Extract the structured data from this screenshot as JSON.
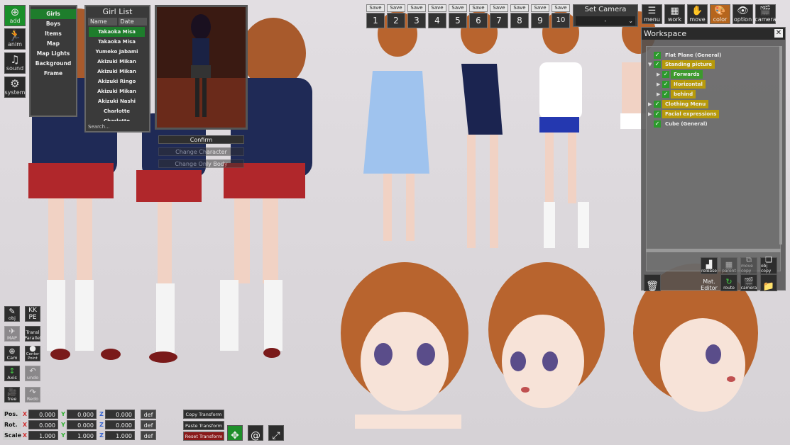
{
  "side_menu": {
    "add": "add",
    "anim": "anim",
    "sound": "sound",
    "system": "system"
  },
  "category_list": [
    "Girls",
    "Boys",
    "Items",
    "Map",
    "Map Lights",
    "Background",
    "Frame"
  ],
  "girl_list": {
    "title": "Girl List",
    "sort_name": "Name",
    "sort_date": "Date",
    "rows": [
      "Takaoka Misa",
      "Takaoka Misa",
      "Yumeko Jabami",
      "Akizuki Mikan",
      "Akizuki Mikan",
      "Akizuki Ringo",
      "Akizuki Mikan",
      "Akizuki Nashi",
      "Charlotte",
      "Charlotte"
    ],
    "search_placeholder": "Search..."
  },
  "preview_buttons": {
    "confirm": "Confirm",
    "change_character": "Change Character",
    "change_only_body": "Change Only Body"
  },
  "camera_slots": {
    "save_label": "Save",
    "numbers": [
      "1",
      "2",
      "3",
      "4",
      "5",
      "6",
      "7",
      "8",
      "9",
      "10"
    ]
  },
  "set_camera": {
    "title": "Set Camera",
    "value": "-"
  },
  "top_icons": [
    "menu",
    "work",
    "move",
    "color",
    "option",
    "camera"
  ],
  "workspace": {
    "title": "Workspace",
    "close": "✕",
    "nodes": [
      "Flat Plane (General)",
      "Standing picture",
      "Forwards",
      "Horizontal",
      "behind",
      "Clothing Menu",
      "Facial expressions",
      "Cube (General)"
    ],
    "buttons": {
      "release": "release",
      "parent": "parent",
      "move_copy": "move copy",
      "obj_copy": "obj copy",
      "mat_editor_line1": "Mat.",
      "mat_editor_line2": "Editor",
      "route": "route",
      "camera": "camera"
    }
  },
  "tools": {
    "obj": "obj",
    "kkpe_line1": "KK",
    "kkpe_line2": "PE",
    "map": "MAP",
    "transl_line1": "Transl",
    "transl_line2": "Parallel",
    "cam": "Cam",
    "center_line1": "Center",
    "center_line2": "Point",
    "axis": "Axis",
    "undo": "undo",
    "free": "free",
    "redo": "Redo"
  },
  "transform": {
    "pos_label": "Pos.",
    "rot_label": "Rot.",
    "scale_label": "Scale",
    "axis_x": "X",
    "axis_y": "Y",
    "axis_z": "Z",
    "pos": [
      "0.000",
      "0.000",
      "0.000"
    ],
    "rot": [
      "0.000",
      "0.000",
      "0.000"
    ],
    "scale": [
      "1.000",
      "1.000",
      "1.000"
    ],
    "def_label": "def",
    "copy_transform": "Copy Transform",
    "paste_transform": "Paste Transform",
    "reset_transform": "Reset Transform"
  }
}
